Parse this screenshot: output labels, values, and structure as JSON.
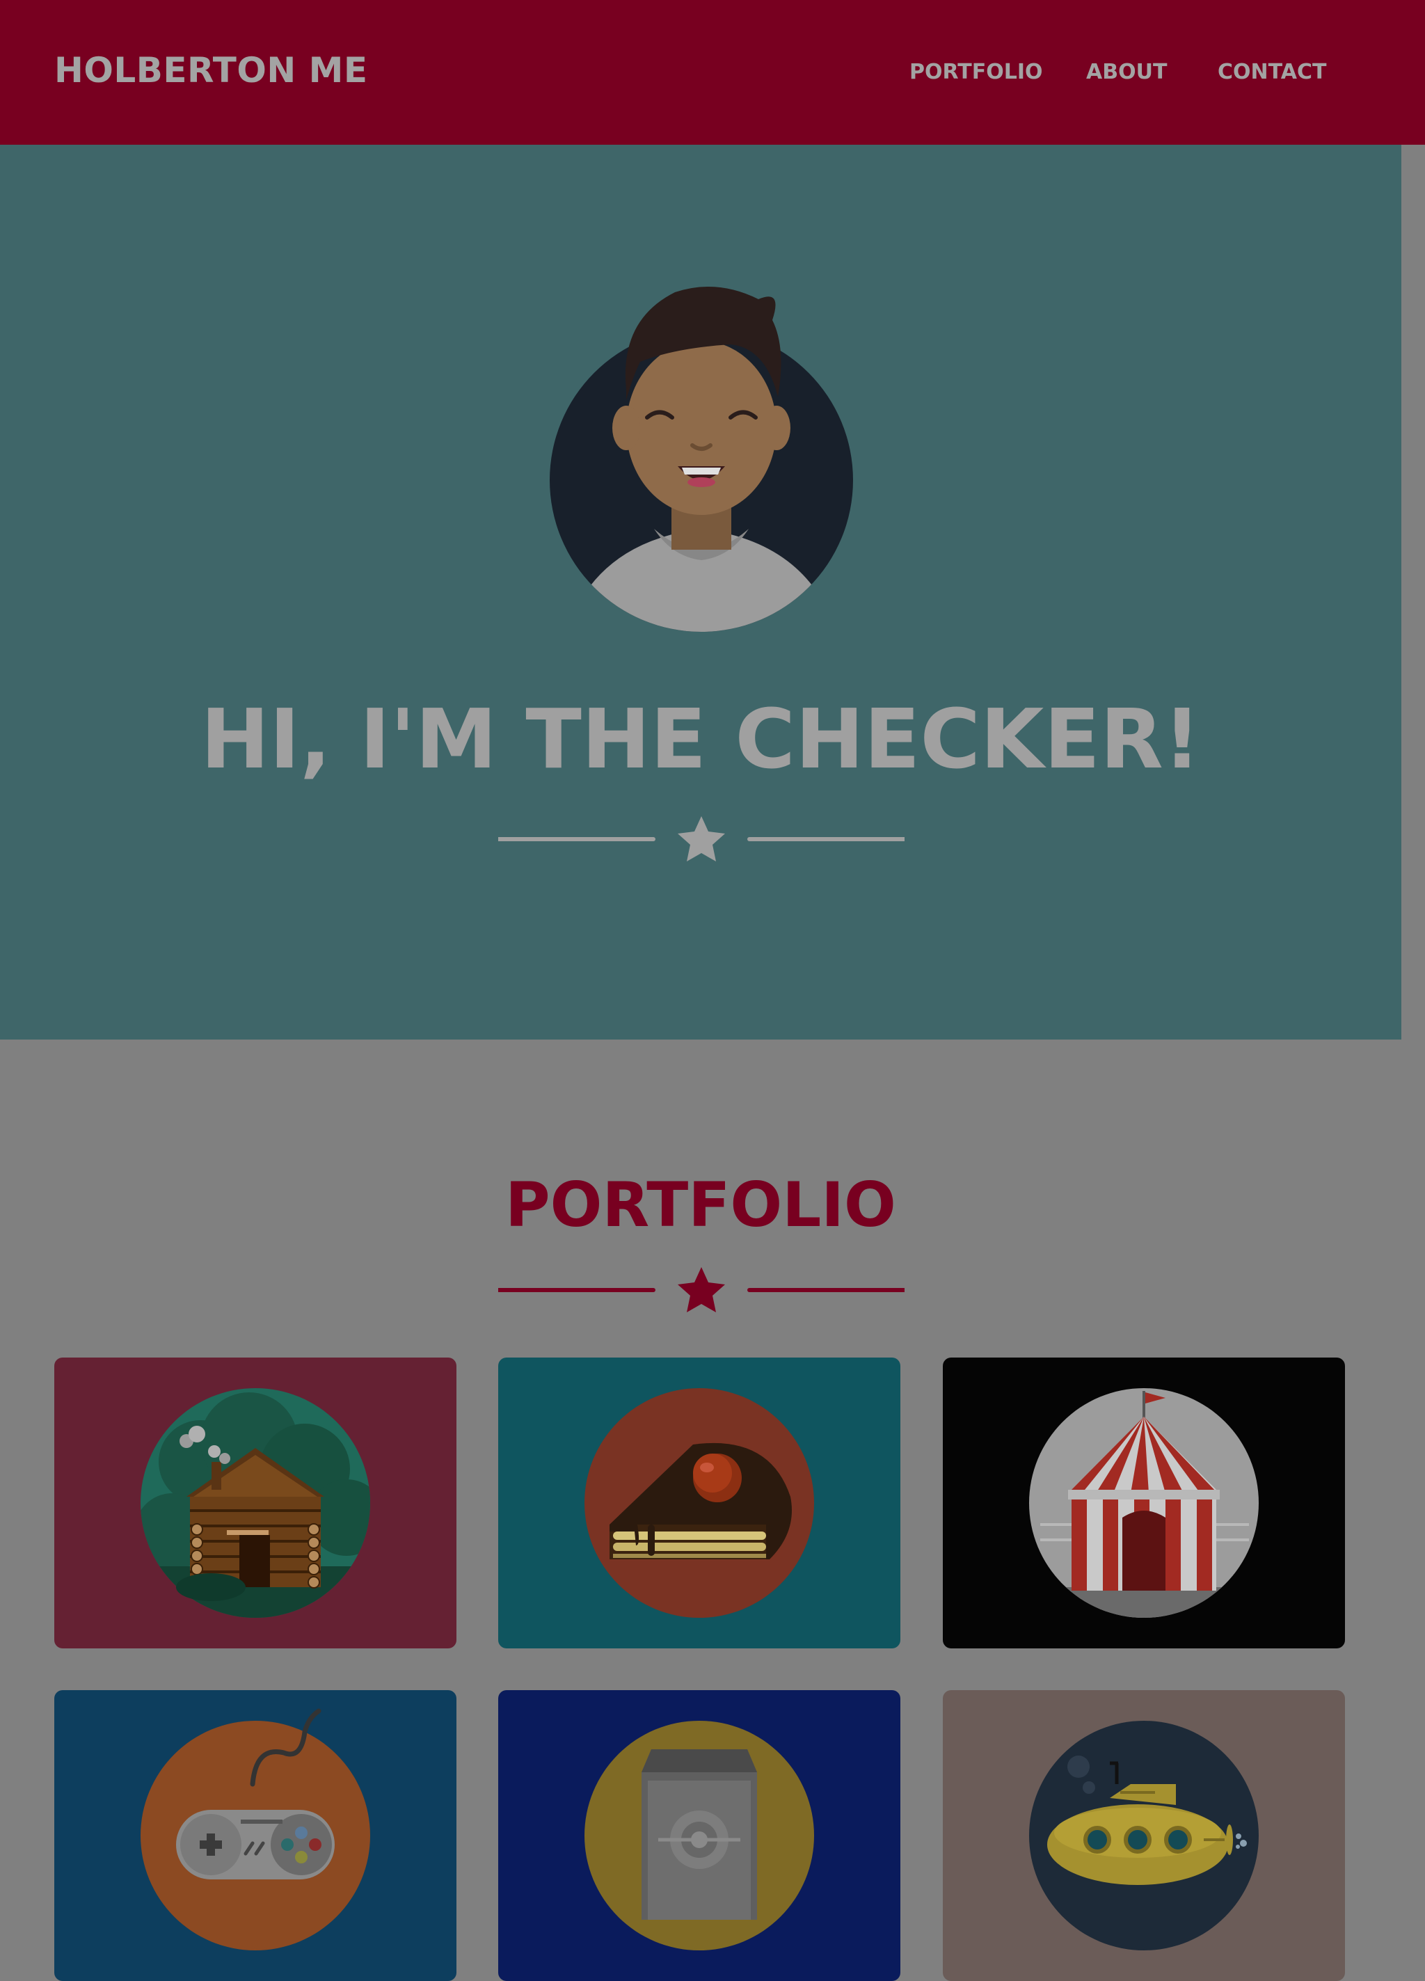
{
  "navbar": {
    "brand": "HOLBERTON ME",
    "links": [
      "PORTFOLIO",
      "ABOUT",
      "CONTACT"
    ]
  },
  "hero": {
    "title": "HI, I'M THE CHECKER!",
    "avatar_icon": "smiling-man-avatar"
  },
  "portfolio": {
    "title": "PORTFOLIO",
    "items": [
      {
        "icon": "log-cabin-icon",
        "bg": "#652133"
      },
      {
        "icon": "cake-slice-icon",
        "bg": "#0f555f"
      },
      {
        "icon": "circus-tent-icon",
        "bg": "#050505"
      },
      {
        "icon": "game-controller-icon",
        "bg": "#0d3e5e"
      },
      {
        "icon": "safe-icon",
        "bg": "#0a1b5c"
      },
      {
        "icon": "submarine-icon",
        "bg": "#6b5c58"
      }
    ]
  },
  "colors": {
    "navbar": "#780020",
    "hero": "#3f6669",
    "page": "#808080",
    "accent": "#780020"
  }
}
